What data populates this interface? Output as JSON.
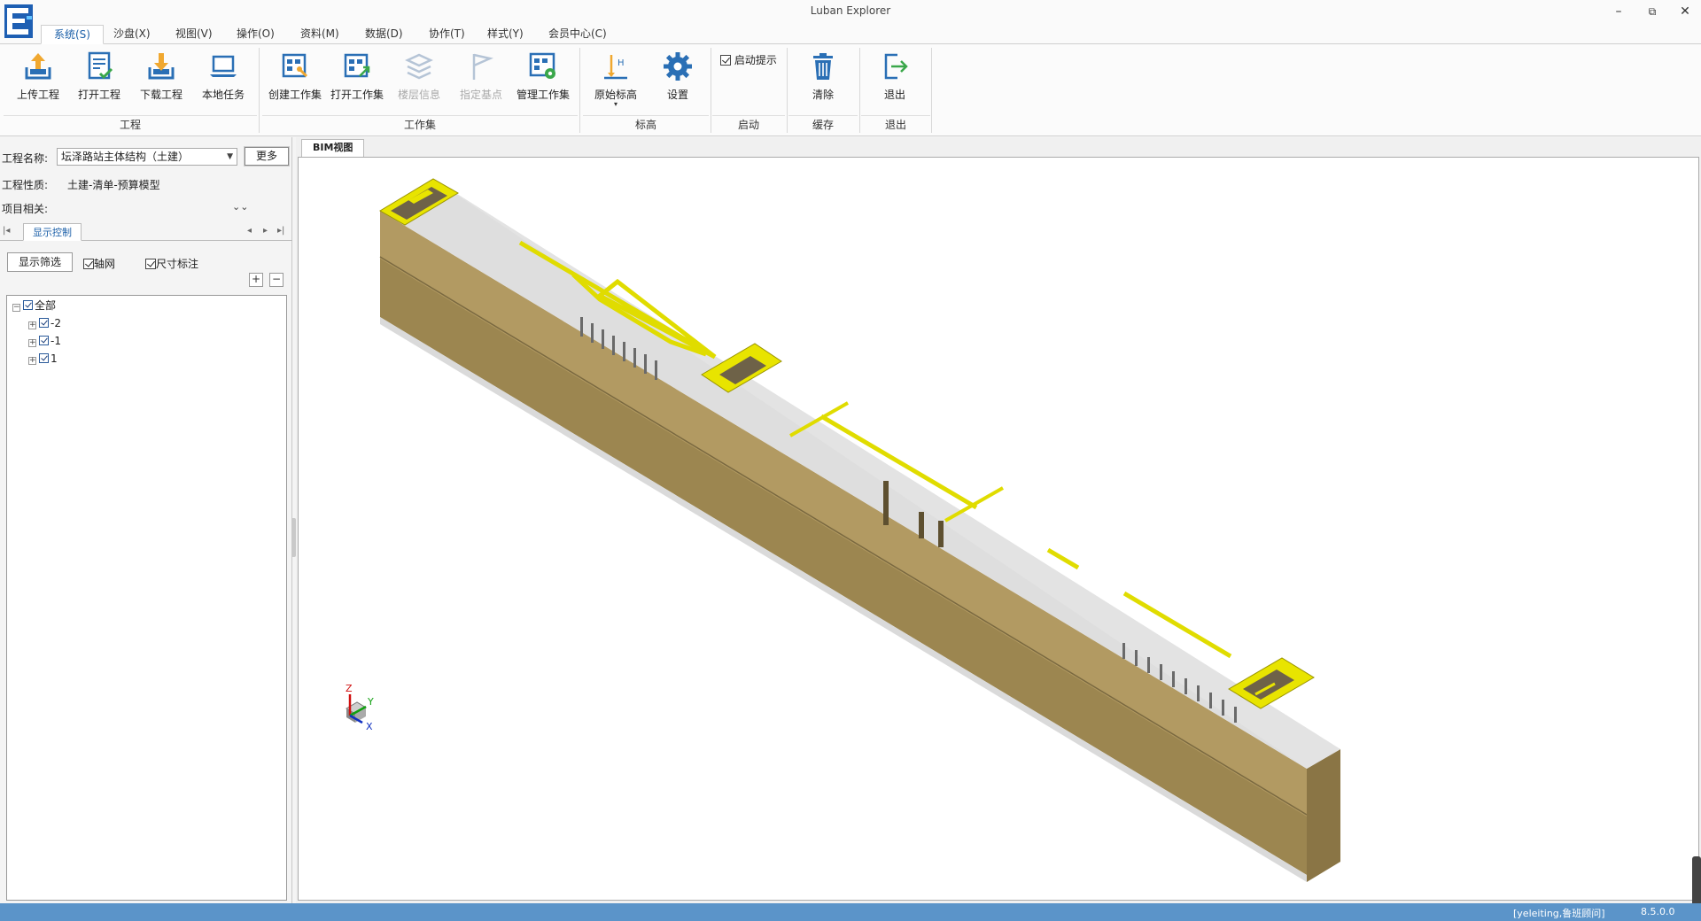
{
  "window": {
    "title": "Luban Explorer",
    "minimize": "–",
    "restore": "⧉",
    "close": "✕"
  },
  "menu": [
    "系统(S)",
    "沙盘(X)",
    "视图(V)",
    "操作(O)",
    "资料(M)",
    "数据(D)",
    "协作(T)",
    "样式(Y)",
    "会员中心(C)"
  ],
  "ribbon": {
    "groups": {
      "project": "工程",
      "workset": "工作集",
      "elevation": "标高",
      "startup": "启动",
      "cache": "缓存",
      "exit": "退出"
    },
    "buttons": {
      "upload": "上传工程",
      "open": "打开工程",
      "download": "下载工程",
      "local_task": "本地任务",
      "create_workset": "创建工作集",
      "open_workset": "打开工作集",
      "floor_info": "楼层信息",
      "set_basepoint": "指定基点",
      "manage_workset": "管理工作集",
      "origin_elevation": "原始标高",
      "settings": "设置",
      "startup_tip": "启动提示",
      "clear": "清除",
      "exit": "退出"
    }
  },
  "left_panel": {
    "project_name_label": "工程名称:",
    "project_name_value": "坛泽路站主体结构（土建）",
    "more_button": "更多",
    "project_type_label": "工程性质:",
    "project_type_value": "土建-清单-预算模型",
    "project_related_label": "项目相关:",
    "tab_display": "显示控制",
    "filter_button": "显示筛选",
    "axis_grid": "轴网",
    "dimension": "尺寸标注",
    "plus": "+",
    "minus": "−",
    "tree": {
      "root": "全部",
      "children": [
        "-2",
        "-1",
        "1"
      ]
    }
  },
  "view": {
    "tab": "BIM视图",
    "axes": {
      "z": "Z",
      "y": "Y",
      "x": "X"
    }
  },
  "status": {
    "user": "[yeleiting,鲁班顾问]",
    "version": "8.5.0.0"
  },
  "colors": {
    "accent": "#1b5fa8",
    "statusbar": "#5b94c9",
    "model_top": "#dcdcdc",
    "model_side": "#a48c55",
    "model_highlight": "#e6e000"
  }
}
